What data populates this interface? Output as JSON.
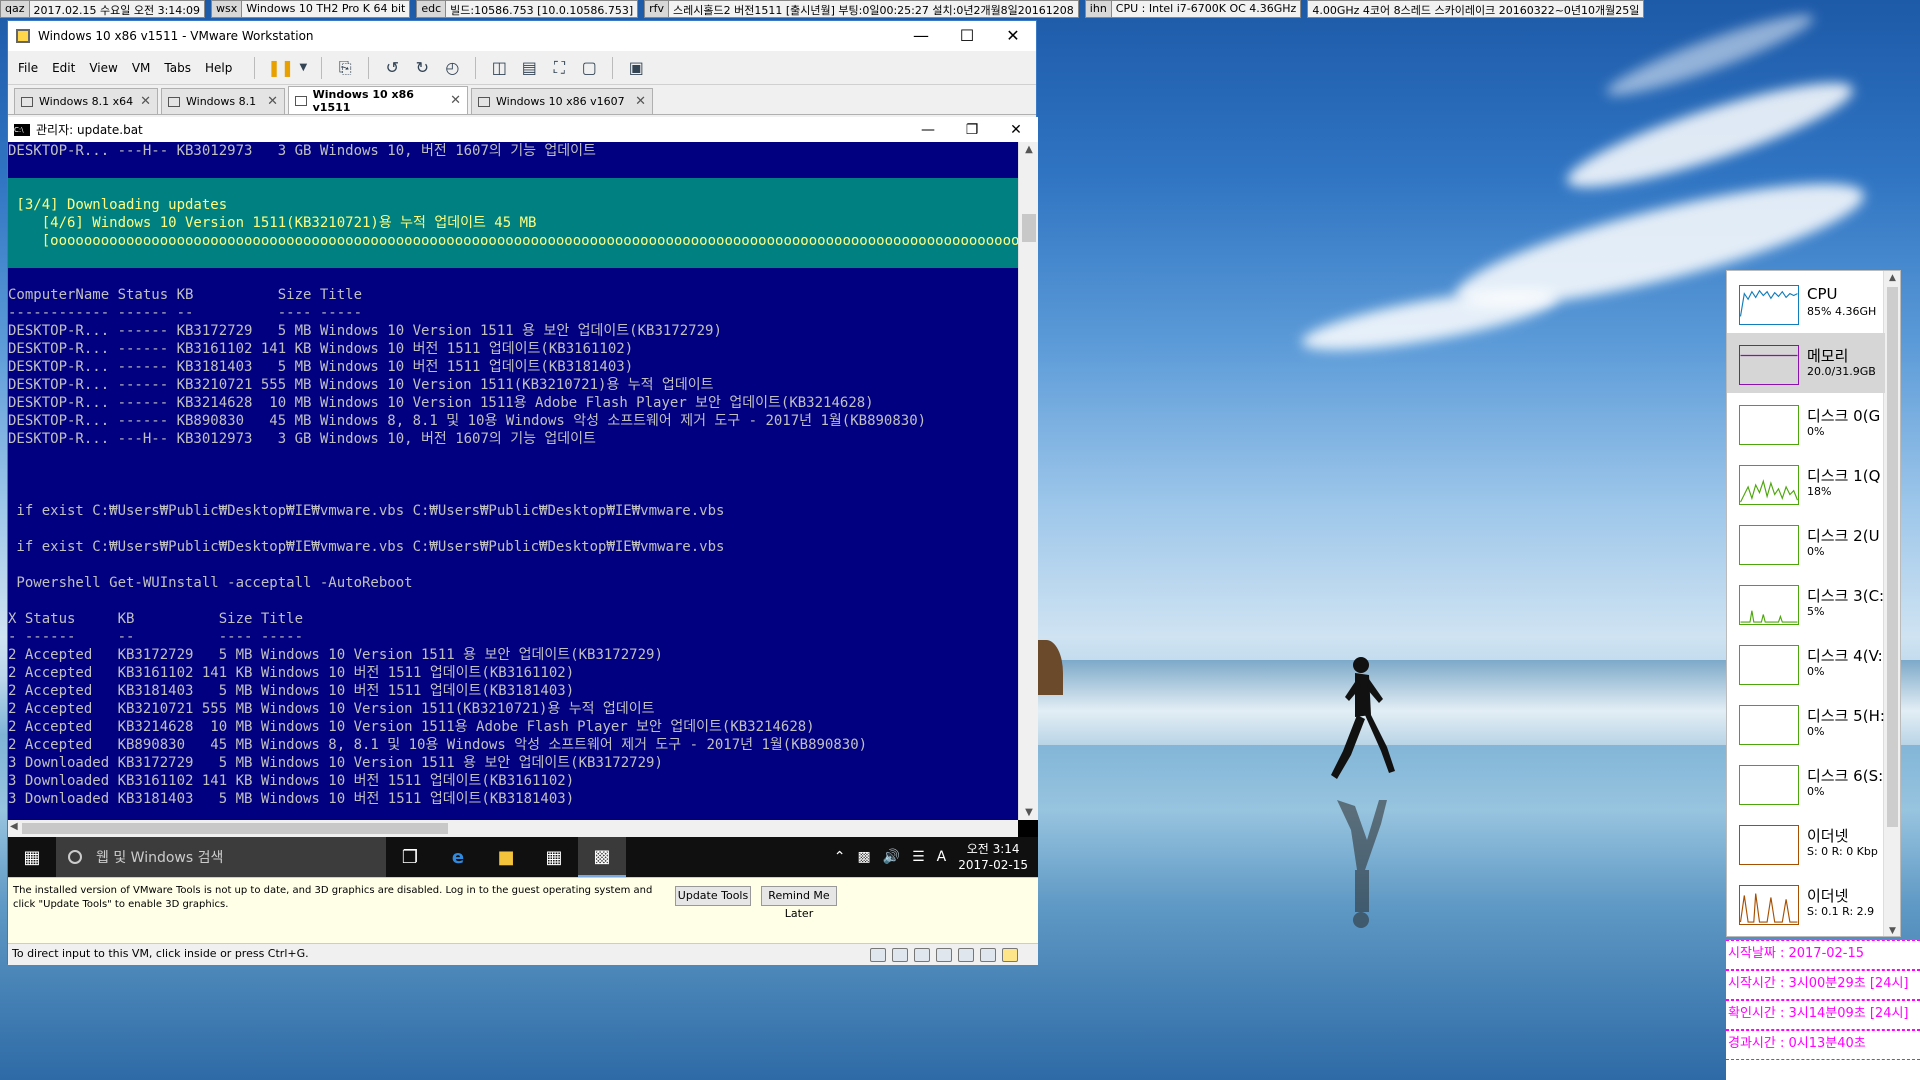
{
  "top_bar": [
    {
      "key": "qaz",
      "value": "2017.02.15 수요일 오전 3:14:09"
    },
    {
      "key": "wsx",
      "value": "Windows 10 TH2 Pro K 64 bit"
    },
    {
      "key": "edc",
      "value": "빌드:10586.753 [10.0.10586.753]"
    },
    {
      "key": "rfv",
      "value": "스레시홀드2 버전1511 [출시년월] 부팅:0일00:25:27 설치:0년2개월8일20161208"
    },
    {
      "key": "ihn",
      "value": "CPU : Intel i7-6700K OC 4.36GHz"
    },
    {
      "key": "",
      "value": "4.00GHz 4코어 8스레드 스카이레이크 20160322~0년10개월25일"
    }
  ],
  "vmware": {
    "title": "Windows 10 x86 v1511 - VMware Workstation",
    "menu": [
      "File",
      "Edit",
      "View",
      "VM",
      "Tabs",
      "Help"
    ],
    "tabs": [
      {
        "label": "Windows 8.1 x64",
        "active": false
      },
      {
        "label": "Windows 8.1",
        "active": false
      },
      {
        "label": "Windows 10 x86 v1511",
        "active": true
      },
      {
        "label": "Windows 10 x86 v1607",
        "active": false
      }
    ],
    "notification": "The installed version of VMware Tools is not up to date, and 3D graphics are disabled. Log in to the guest operating system and click \"Update Tools\" to enable 3D graphics.",
    "update_tools_label": "Update Tools",
    "remind_label": "Remind Me Later",
    "status_text": "To direct input to this VM, click inside or press Ctrl+G."
  },
  "cmd": {
    "title": "관리자:  update.bat",
    "lines": [
      {
        "text": "DESKTOP-R... ---H-- KB3012973   3 GB Windows 10, 버전 1607의 기능 업데이트",
        "band": false
      },
      {
        "text": "",
        "band": false
      },
      {
        "text": "",
        "band": true
      },
      {
        "text": " [3/4] Downloading updates",
        "band": true
      },
      {
        "text": "    [4/6] Windows 10 Version 1511(KB3210721)용 누적 업데이트 45 MB",
        "band": true
      },
      {
        "text": "    [ooooooooooooooooooooooooooooooooooooooooooooooooooooooooooooooooooooooooooooooooooooooooooooooooooooooooooooooooooooooooooooooooooooooooooooo",
        "band": true
      },
      {
        "text": "",
        "band": true
      },
      {
        "text": "",
        "band": false
      },
      {
        "text": "ComputerName Status KB          Size Title",
        "band": false
      },
      {
        "text": "------------ ------ --          ---- -----",
        "band": false
      },
      {
        "text": "DESKTOP-R... ------ KB3172729   5 MB Windows 10 Version 1511 용 보안 업데이트(KB3172729)",
        "band": false
      },
      {
        "text": "DESKTOP-R... ------ KB3161102 141 KB Windows 10 버전 1511 업데이트(KB3161102)",
        "band": false
      },
      {
        "text": "DESKTOP-R... ------ KB3181403   5 MB Windows 10 버전 1511 업데이트(KB3181403)",
        "band": false
      },
      {
        "text": "DESKTOP-R... ------ KB3210721 555 MB Windows 10 Version 1511(KB3210721)용 누적 업데이트",
        "band": false
      },
      {
        "text": "DESKTOP-R... ------ KB3214628  10 MB Windows 10 Version 1511용 Adobe Flash Player 보안 업데이트(KB3214628)",
        "band": false
      },
      {
        "text": "DESKTOP-R... ------ KB890830   45 MB Windows 8, 8.1 및 10용 Windows 악성 소프트웨어 제거 도구 - 2017년 1월(KB890830)",
        "band": false
      },
      {
        "text": "DESKTOP-R... ---H-- KB3012973   3 GB Windows 10, 버전 1607의 기능 업데이트",
        "band": false
      },
      {
        "text": "",
        "band": false
      },
      {
        "text": "",
        "band": false
      },
      {
        "text": "",
        "band": false
      },
      {
        "text": " if exist C:₩Users₩Public₩Desktop₩IE₩vmware.vbs C:₩Users₩Public₩Desktop₩IE₩vmware.vbs",
        "band": false
      },
      {
        "text": "",
        "band": false
      },
      {
        "text": " if exist C:₩Users₩Public₩Desktop₩IE₩vmware.vbs C:₩Users₩Public₩Desktop₩IE₩vmware.vbs",
        "band": false
      },
      {
        "text": "",
        "band": false
      },
      {
        "text": " Powershell Get-WUInstall -acceptall -AutoReboot",
        "band": false
      },
      {
        "text": "",
        "band": false
      },
      {
        "text": "X Status     KB          Size Title",
        "band": false
      },
      {
        "text": "- ------     --          ---- -----",
        "band": false
      },
      {
        "text": "2 Accepted   KB3172729   5 MB Windows 10 Version 1511 용 보안 업데이트(KB3172729)",
        "band": false
      },
      {
        "text": "2 Accepted   KB3161102 141 KB Windows 10 버전 1511 업데이트(KB3161102)",
        "band": false
      },
      {
        "text": "2 Accepted   KB3181403   5 MB Windows 10 버전 1511 업데이트(KB3181403)",
        "band": false
      },
      {
        "text": "2 Accepted   KB3210721 555 MB Windows 10 Version 1511(KB3210721)용 누적 업데이트",
        "band": false
      },
      {
        "text": "2 Accepted   KB3214628  10 MB Windows 10 Version 1511용 Adobe Flash Player 보안 업데이트(KB3214628)",
        "band": false
      },
      {
        "text": "2 Accepted   KB890830   45 MB Windows 8, 8.1 및 10용 Windows 악성 소프트웨어 제거 도구 - 2017년 1월(KB890830)",
        "band": false
      },
      {
        "text": "3 Downloaded KB3172729   5 MB Windows 10 Version 1511 용 보안 업데이트(KB3172729)",
        "band": false
      },
      {
        "text": "3 Downloaded KB3161102 141 KB Windows 10 버전 1511 업데이트(KB3161102)",
        "band": false
      },
      {
        "text": "3 Downloaded KB3181403   5 MB Windows 10 버전 1511 업데이트(KB3181403)",
        "band": false
      }
    ]
  },
  "taskbar": {
    "search_placeholder": "웹 및 Windows 검색",
    "ime": "A",
    "time": "오전 3:14",
    "date": "2017-02-15"
  },
  "perf": [
    {
      "name": "CPU",
      "value": "85% 4.36GH",
      "color": "#117dbb",
      "selected": false
    },
    {
      "name": "메모리",
      "value": "20.0/31.9GB",
      "color": "#8b12ae",
      "selected": true
    },
    {
      "name": "디스크 0(G",
      "value": "0%",
      "color": "#4da60c",
      "selected": false
    },
    {
      "name": "디스크 1(Q",
      "value": "18%",
      "color": "#4da60c",
      "selected": false
    },
    {
      "name": "디스크 2(U",
      "value": "0%",
      "color": "#4da60c",
      "selected": false
    },
    {
      "name": "디스크 3(C:",
      "value": "5%",
      "color": "#4da60c",
      "selected": false
    },
    {
      "name": "디스크 4(V:",
      "value": "0%",
      "color": "#4da60c",
      "selected": false
    },
    {
      "name": "디스크 5(H:",
      "value": "0%",
      "color": "#4da60c",
      "selected": false
    },
    {
      "name": "디스크 6(S:",
      "value": "0%",
      "color": "#4da60c",
      "selected": false
    },
    {
      "name": "이더넷",
      "value": "S: 0 R: 0 Kbp",
      "color": "#a74f01",
      "selected": false
    },
    {
      "name": "이더넷",
      "value": "S: 0.1 R: 2.9",
      "color": "#a74f01",
      "selected": false
    }
  ],
  "times": [
    "시작날짜 : 2017-02-15",
    "시작시간 : 3시00분29초 [24시]",
    "확인시간 : 3시14분09초 [24시]",
    "경과시간 : 0시13분40초"
  ]
}
